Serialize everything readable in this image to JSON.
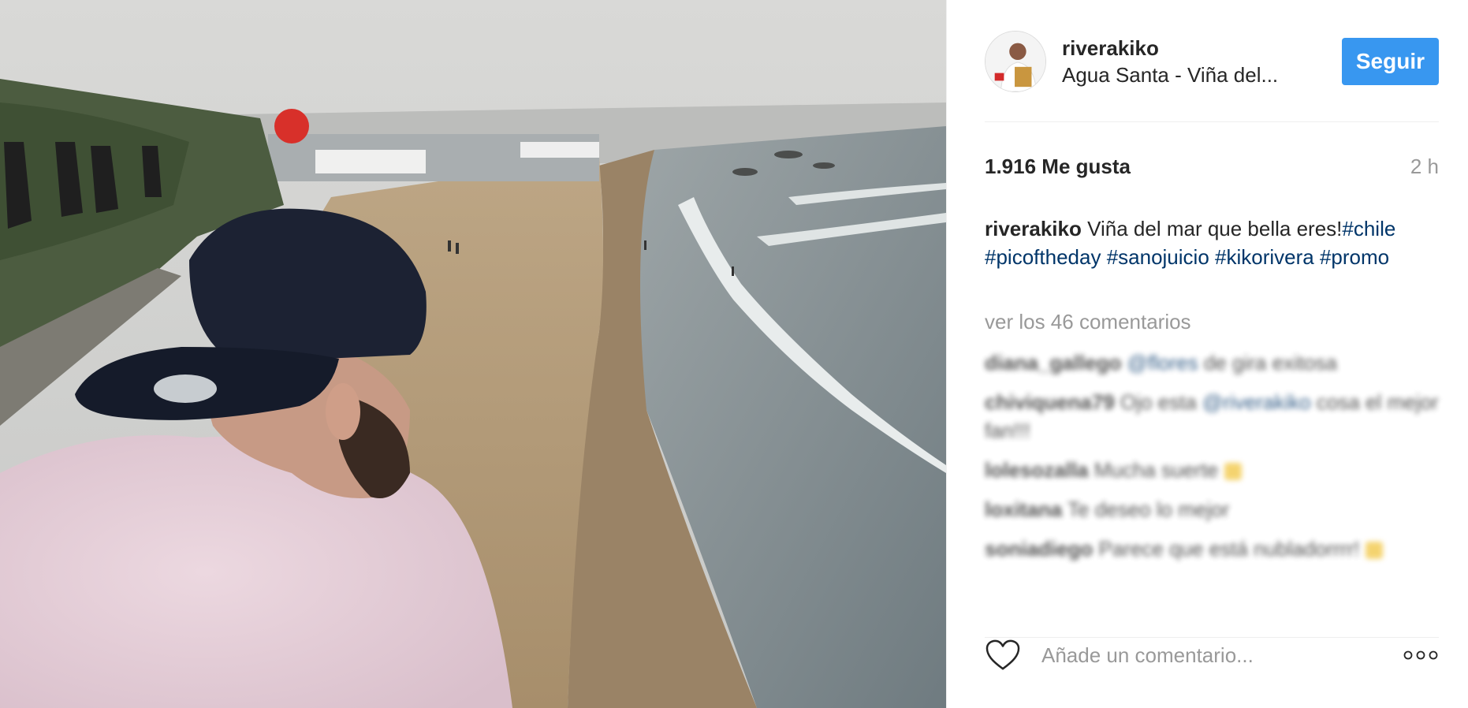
{
  "post": {
    "author": {
      "username": "riverakiko",
      "location": "Agua Santa - Viña del..."
    },
    "follow_label": "Seguir",
    "likes": "1.916 Me gusta",
    "time_ago": "2 h",
    "caption": {
      "username": "riverakiko",
      "text": "Viña del mar que bella eres!",
      "hashtags": [
        "#chile",
        "#picoftheday",
        "#sanojuicio",
        "#kikorivera",
        "#promo"
      ]
    },
    "view_comments_label": "ver los 46 comentarios",
    "comments": [
      {
        "username": "diana_gallego",
        "mention": "@flores",
        "text": "de gira exitosa"
      },
      {
        "username": "chiviquena79",
        "text": "Ojo esta",
        "mention": "@riverakiko",
        "text2": "cosa el mejor fan!!!"
      },
      {
        "username": "lolesozalla",
        "text": "Mucha suerte"
      },
      {
        "username": "loxitana",
        "text": "Te deseo lo mejor"
      },
      {
        "username": "soniadiego",
        "text": "Parece que está nubladorrrr!"
      }
    ],
    "comment_placeholder": "Añade un comentario...",
    "icons": {
      "like": "heart-outline-icon",
      "options": "more-options-icon"
    },
    "colors": {
      "follow_button": "#3897f0",
      "hashtag": "#003569",
      "muted_text": "#999999"
    }
  }
}
